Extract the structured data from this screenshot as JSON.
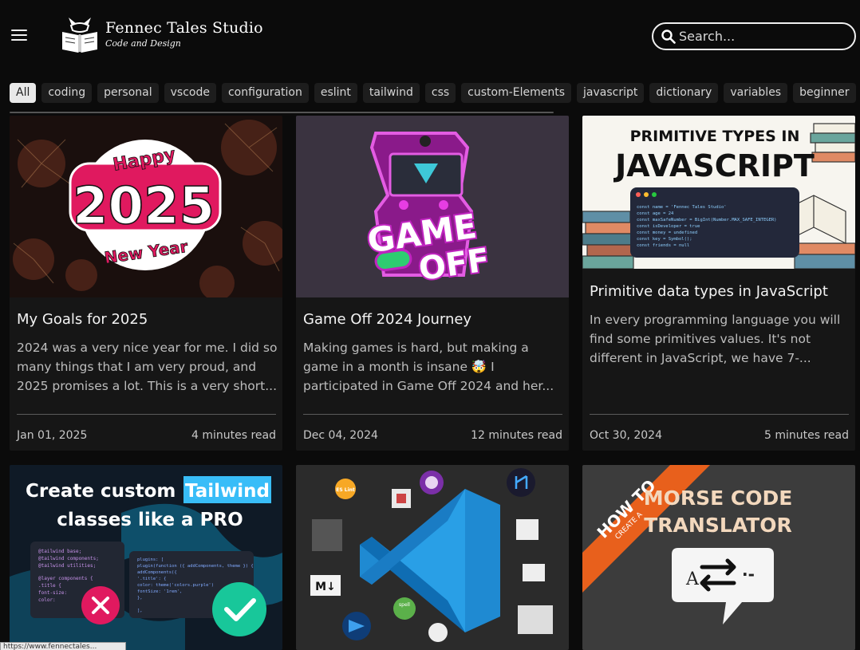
{
  "header": {
    "brand_title": "Fennec Tales Studio",
    "brand_subtitle": "Code and Design",
    "menu_icon": "hamburger-icon",
    "logo_icon": "fennec-book-logo"
  },
  "search": {
    "placeholder": "Search...",
    "icon": "search-icon"
  },
  "tags": [
    {
      "label": "All",
      "active": true
    },
    {
      "label": "coding"
    },
    {
      "label": "personal"
    },
    {
      "label": "vscode"
    },
    {
      "label": "configuration"
    },
    {
      "label": "eslint"
    },
    {
      "label": "tailwind"
    },
    {
      "label": "css"
    },
    {
      "label": "custom-Elements"
    },
    {
      "label": "javascript"
    },
    {
      "label": "dictionary"
    },
    {
      "label": "variables"
    },
    {
      "label": "beginner"
    }
  ],
  "posts": [
    {
      "title": "My Goals for 2025",
      "excerpt": "2024 was a very nice year for me. I did so many things that I am very proud, and 2025 promises a lot. This is a very short...",
      "date": "Jan 01, 2025",
      "read_time": "4 minutes read",
      "image": {
        "happy": "Happy",
        "year": "2025",
        "new_year": "New Year"
      }
    },
    {
      "title": "Game Off 2024 Journey",
      "excerpt": "Making games is hard, but making a game in a month is insane 🤯 I participated in Game Off 2024 and her...",
      "date": "Dec 04, 2024",
      "read_time": "12 minutes read",
      "image": {
        "line1": "GAME",
        "line2": "OFF"
      }
    },
    {
      "title": "Primitive data types in JavaScript",
      "excerpt": "In every programming language you will find some primitives values. It's not different in JavaScript, we have 7-...",
      "date": "Oct 30, 2024",
      "read_time": "5 minutes read",
      "image": {
        "line1": "PRIMITIVE TYPES IN",
        "line2": "JAVASCRIPT",
        "code": [
          "const name = 'Fennec Tales Studio'",
          "const age = 24",
          "const maxSafeNumber = BigInt(Number.MAX_SAFE_INTEGER)",
          "const isDeveloper = true",
          "const money = undefined",
          "const key = Symbol();",
          "const friends = null"
        ]
      }
    },
    {
      "title": "",
      "image": {
        "line1": "Create custom",
        "highlight": "Tailwind",
        "line2": "classes like a PRO",
        "code_left": [
          "@tailwind base;",
          "@tailwind components;",
          "@tailwind utilities;",
          "",
          "@layer components {",
          "  .title {",
          "    font-size:",
          "    color:",
          "  }",
          "}"
        ],
        "code_right": [
          "plugins: [",
          "  plugin(function ({ addComponents, theme }) {",
          "    addComponents({",
          "      '.title': {",
          "        color: theme('colors.purple')",
          "        fontSize: '1rem',",
          "      },",
          "    })",
          "  }),",
          "],"
        ]
      }
    },
    {
      "title": "",
      "image": {
        "eslint": "ES Lint",
        "markdown": "M↓",
        "spell": "spell"
      }
    },
    {
      "title": "",
      "image": {
        "ribbon1": "HOW TO",
        "ribbon2": "CREATE A",
        "line1": "MORSE CODE",
        "line2": "TRANSLATOR",
        "glyph_a": "A",
        "glyph_b": "·-"
      }
    }
  ],
  "status": {
    "url": "https://www.fennectales..."
  }
}
